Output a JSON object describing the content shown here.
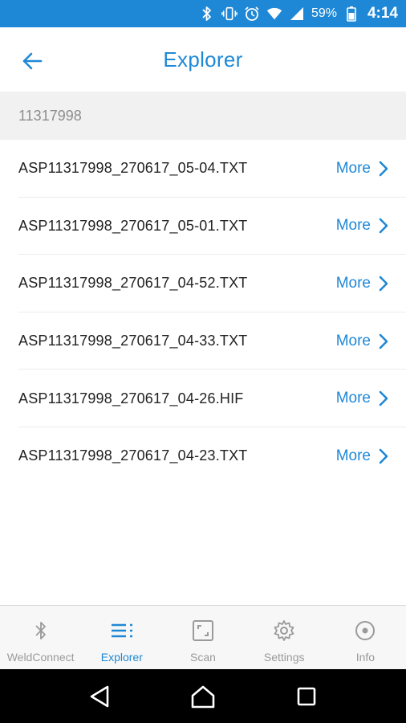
{
  "status_bar": {
    "battery_percent": "59%",
    "time": "4:14",
    "icons": [
      "bluetooth-icon",
      "vibrate-icon",
      "alarm-icon",
      "wifi-icon",
      "signal-icon",
      "battery-icon"
    ]
  },
  "header": {
    "title": "Explorer",
    "back_icon": "back-arrow-icon"
  },
  "section": {
    "label": "11317998"
  },
  "files": [
    {
      "name": "ASP11317998_270617_05-04.TXT",
      "action": "More"
    },
    {
      "name": "ASP11317998_270617_05-01.TXT",
      "action": "More"
    },
    {
      "name": "ASP11317998_270617_04-52.TXT",
      "action": "More"
    },
    {
      "name": "ASP11317998_270617_04-33.TXT",
      "action": "More"
    },
    {
      "name": "ASP11317998_270617_04-26.HIF",
      "action": "More"
    },
    {
      "name": "ASP11317998_270617_04-23.TXT",
      "action": "More"
    }
  ],
  "bottom_nav": {
    "active": "Explorer",
    "items": [
      {
        "label": "WeldConnect",
        "icon": "bluetooth-icon"
      },
      {
        "label": "Explorer",
        "icon": "list-icon"
      },
      {
        "label": "Scan",
        "icon": "scan-icon"
      },
      {
        "label": "Settings",
        "icon": "gear-icon"
      },
      {
        "label": "Info",
        "icon": "info-icon"
      }
    ]
  },
  "colors": {
    "accent": "#1f88d6",
    "status_bar": "#1f88d6",
    "section_bg": "#f1f1f1",
    "nav_inactive": "#9a9a9a"
  }
}
